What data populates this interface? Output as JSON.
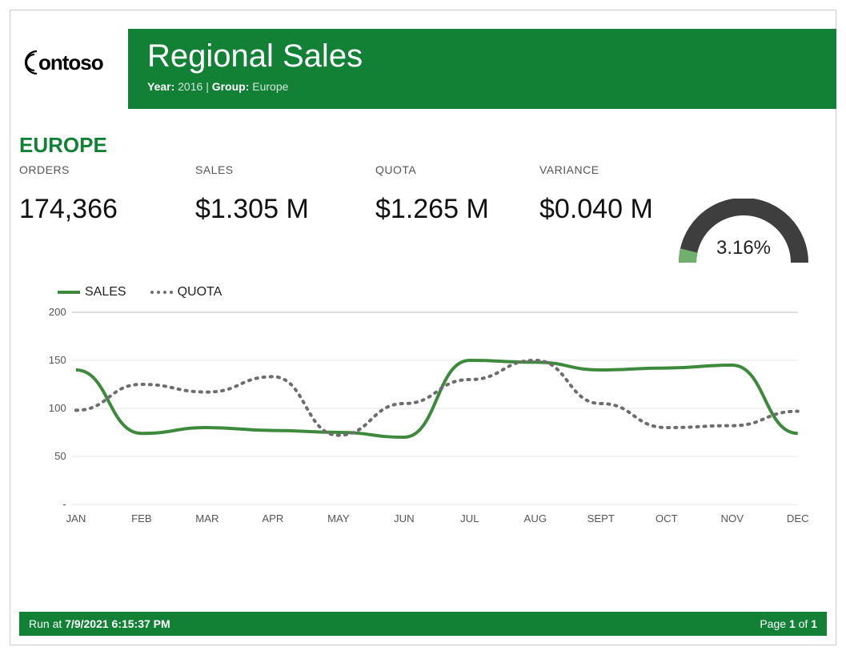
{
  "logo": {
    "text": "Contoso"
  },
  "header": {
    "title": "Regional Sales",
    "year_label": "Year:",
    "year_value": "2016",
    "group_label": "Group:",
    "group_value": "Europe"
  },
  "region": "EUROPE",
  "kpis": {
    "orders": {
      "label": "ORDERS",
      "value": "174,366"
    },
    "sales": {
      "label": "SALES",
      "value": "$1.305 M"
    },
    "quota": {
      "label": "QUOTA",
      "value": "$1.265 M"
    },
    "variance": {
      "label": "VARIANCE",
      "value": "$0.040 M"
    }
  },
  "gauge": {
    "percent_text": "3.16%",
    "percent_value": 3.16
  },
  "legend": {
    "sales": "SALES",
    "quota": "QUOTA"
  },
  "footer": {
    "run_prefix": "Run at",
    "run_at": "7/9/2021 6:15:37 PM",
    "page_prefix": "Page",
    "page_num": "1",
    "page_of": "of",
    "page_total": "1"
  },
  "colors": {
    "brand_green": "#128136",
    "series_green": "#3d8a3d",
    "series_gray": "#6d6d6d",
    "gauge_gray": "#3e3e3e"
  },
  "chart_data": {
    "type": "line",
    "categories": [
      "JAN",
      "FEB",
      "MAR",
      "APR",
      "MAY",
      "JUN",
      "JUL",
      "AUG",
      "SEPT",
      "OCT",
      "NOV",
      "DEC"
    ],
    "series": [
      {
        "name": "SALES",
        "values": [
          140,
          74,
          80,
          77,
          75,
          70,
          150,
          148,
          140,
          142,
          145,
          74
        ]
      },
      {
        "name": "QUOTA",
        "values": [
          98,
          125,
          117,
          133,
          72,
          105,
          130,
          150,
          105,
          80,
          82,
          97
        ]
      }
    ],
    "y_ticks": [
      0,
      50,
      100,
      150,
      200
    ],
    "y_tick_labels": [
      "-",
      "50",
      "100",
      "150",
      "200"
    ],
    "ylim": [
      0,
      200
    ],
    "xlabel": "",
    "ylabel": ""
  }
}
